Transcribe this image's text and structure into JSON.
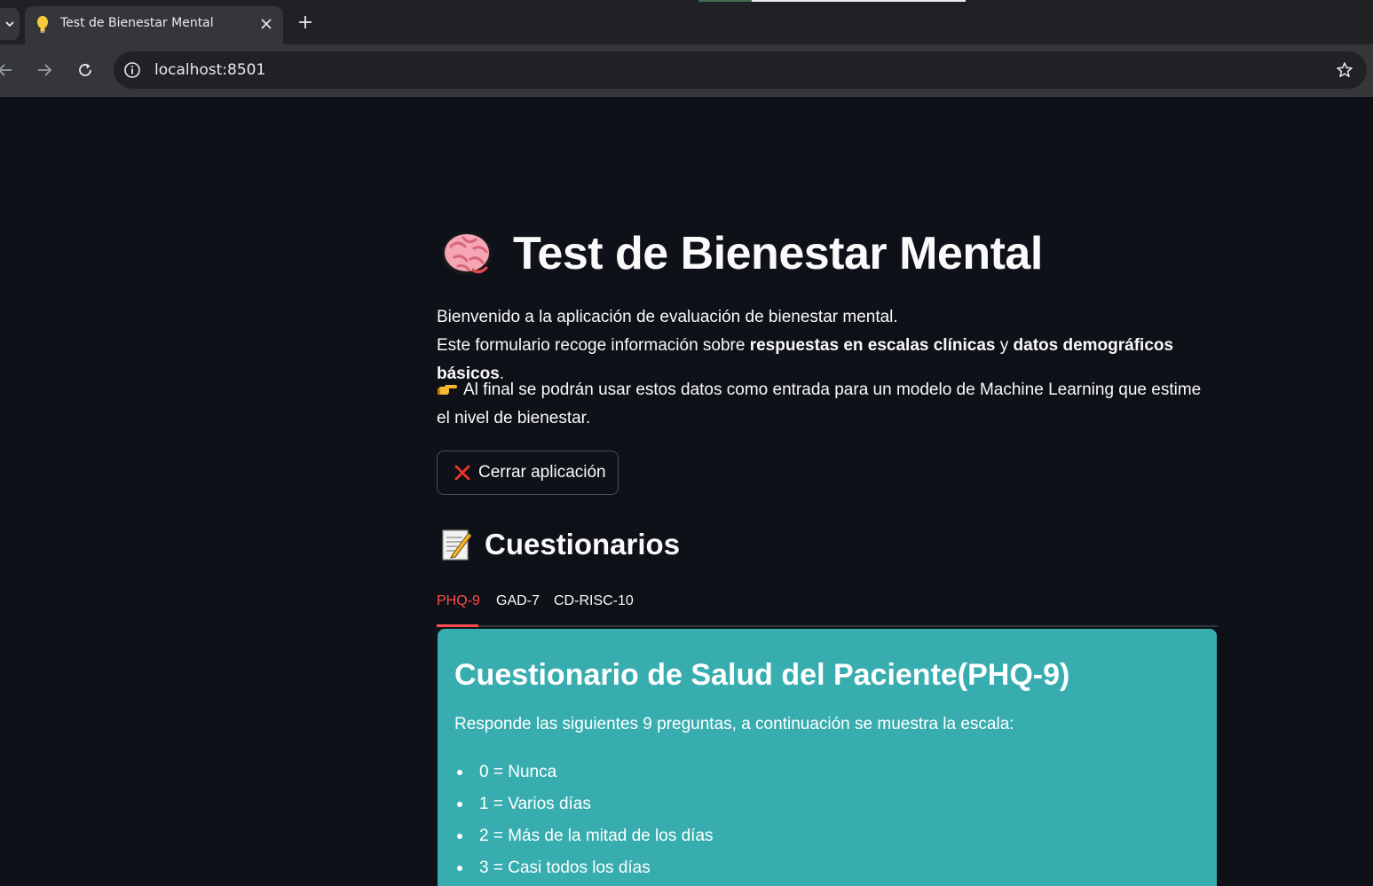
{
  "browser": {
    "tab_title": "Test de Bienestar Mental",
    "url": "localhost:8501"
  },
  "app": {
    "title": "Test de Bienestar Mental",
    "intro_line1": "Bienvenido a la aplicación de evaluación de bienestar mental.",
    "intro_line2_prefix": "Este formulario recoge información sobre ",
    "intro_line2_bold1": "respuestas en escalas clínicas",
    "intro_line2_mid": " y ",
    "intro_line2_bold2": "datos demográficos básicos",
    "intro_line2_suffix": ".",
    "note": "Al final se podrán usar estos datos como entrada para un modelo de Machine Learning que estime el nivel de bienestar.",
    "close_button": "Cerrar aplicación",
    "section_title": "Cuestionarios",
    "tabs": [
      {
        "label": "PHQ-9",
        "active": true
      },
      {
        "label": "GAD-7",
        "active": false
      },
      {
        "label": "CD-RISC-10",
        "active": false
      }
    ],
    "card": {
      "title": "Cuestionario de Salud del Paciente(PHQ-9)",
      "description": "Responde las siguientes 9 preguntas, a continuación se muestra la escala:",
      "scale": [
        "0 = Nunca",
        "1 = Varios días",
        "2 = Más de la mitad de los días",
        "3 = Casi todos los días"
      ]
    }
  },
  "colors": {
    "background": "#0e1117",
    "accent": "#ff4b4b",
    "card": "#38adaf"
  }
}
